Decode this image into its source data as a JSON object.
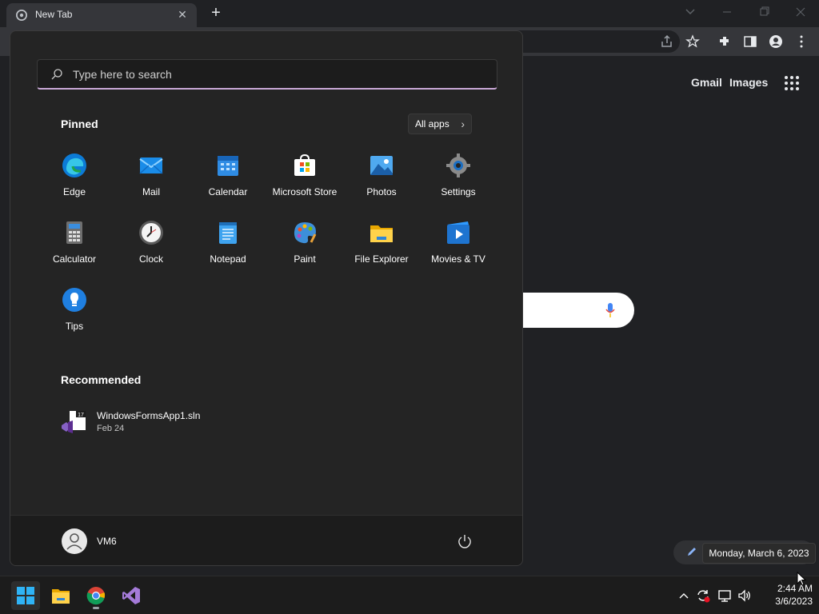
{
  "browser": {
    "tab_title": "New Tab",
    "new_tab_symbol": "+",
    "close_symbol": "✕",
    "links": {
      "gmail": "Gmail",
      "images": "Images"
    }
  },
  "tooltip": {
    "date_full": "Monday, March 6, 2023"
  },
  "start_menu": {
    "search_placeholder": "Type here to search",
    "pinned_title": "Pinned",
    "all_apps_label": "All apps",
    "pinned_apps": [
      {
        "label": "Edge",
        "icon": "edge-icon"
      },
      {
        "label": "Mail",
        "icon": "mail-icon"
      },
      {
        "label": "Calendar",
        "icon": "calendar-icon"
      },
      {
        "label": "Microsoft Store",
        "icon": "store-icon"
      },
      {
        "label": "Photos",
        "icon": "photos-icon"
      },
      {
        "label": "Settings",
        "icon": "settings-icon"
      },
      {
        "label": "Calculator",
        "icon": "calculator-icon"
      },
      {
        "label": "Clock",
        "icon": "clock-icon"
      },
      {
        "label": "Notepad",
        "icon": "notepad-icon"
      },
      {
        "label": "Paint",
        "icon": "paint-icon"
      },
      {
        "label": "File Explorer",
        "icon": "folder-icon"
      },
      {
        "label": "Movies & TV",
        "icon": "movies-icon"
      },
      {
        "label": "Tips",
        "icon": "tips-icon"
      }
    ],
    "recommended_title": "Recommended",
    "recommended": [
      {
        "name": "WindowsFormsApp1.sln",
        "date": "Feb 24",
        "badge": "17"
      }
    ],
    "user_name": "VM6"
  },
  "taskbar": {
    "time": "2:44 AM",
    "date": "3/6/2023",
    "apps": [
      "windows-start-icon",
      "file-explorer-icon",
      "chrome-icon",
      "visual-studio-icon"
    ]
  },
  "colors": {
    "accent": "#c9a8d6",
    "start_bg": "#242424",
    "taskbar_bg": "#1c1c1c"
  }
}
